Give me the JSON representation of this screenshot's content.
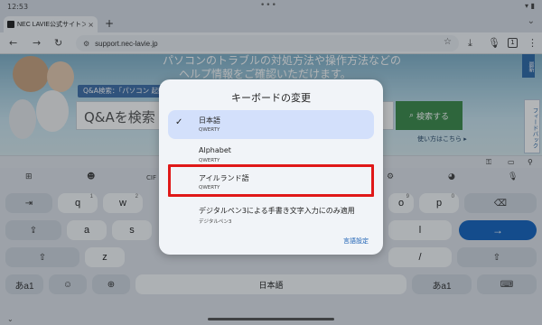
{
  "status": {
    "time": "12:53",
    "dots": "•••"
  },
  "browser": {
    "tab_title": "NEC LAVIE公式サイト＞サ",
    "tab_close": "×",
    "new_tab": "+",
    "url": "support.nec-lavie.jp",
    "tab_count": "1"
  },
  "page": {
    "headline_line1": "パソコンのトラブルの対処方法や操作方法などの",
    "headline_line2": "ヘルプ情報をご確認いただけます。",
    "qa_tag": "Q&A検索：「パソコン 起動",
    "search_placeholder": "Q&Aを検索",
    "search_button": "検索する",
    "howto_link": "使い方はこちら",
    "side_tab_top": "最新",
    "side_tab_feedback": "フィードバック"
  },
  "dialog": {
    "title": "キーボードの変更",
    "options": [
      {
        "name": "日本語",
        "sub": "QWERTY",
        "selected": true
      },
      {
        "name": "Alphabet",
        "sub": "QWERTY",
        "selected": false
      },
      {
        "name": "アイルランド語",
        "sub": "QWERTY",
        "selected": false
      },
      {
        "name": "デジタルペン3による手書き文字入力にのみ適用",
        "sub": "デジタルペン3",
        "selected": false
      }
    ],
    "language_settings": "言語設定"
  },
  "keyboard": {
    "row1": [
      {
        "label": "⇥"
      },
      {
        "label": "q",
        "hint": "1"
      },
      {
        "label": "w",
        "hint": "2"
      },
      {
        "label": "o",
        "hint": "9"
      },
      {
        "label": "p",
        "hint": "0"
      },
      {
        "label": "⌫"
      }
    ],
    "row2": [
      {
        "label": "⇪"
      },
      {
        "label": "a"
      },
      {
        "label": "s"
      },
      {
        "label": "l"
      },
      {
        "label": "→"
      }
    ],
    "row3": [
      {
        "label": "⇧"
      },
      {
        "label": "z"
      },
      {
        "label": "/"
      },
      {
        "label": "⇧"
      }
    ],
    "row4": [
      {
        "label": "あa1"
      },
      {
        "label": "☺"
      },
      {
        "label": "⊕"
      },
      {
        "label": "日本語"
      },
      {
        "label": "あa1"
      },
      {
        "label": "⌨"
      }
    ],
    "suggest_cf": "CIF"
  },
  "colors": {
    "accent": "#1565c0",
    "selected_bg": "#d3e0fb",
    "highlight": "#e01818",
    "search_green": "#3b8b4a"
  }
}
